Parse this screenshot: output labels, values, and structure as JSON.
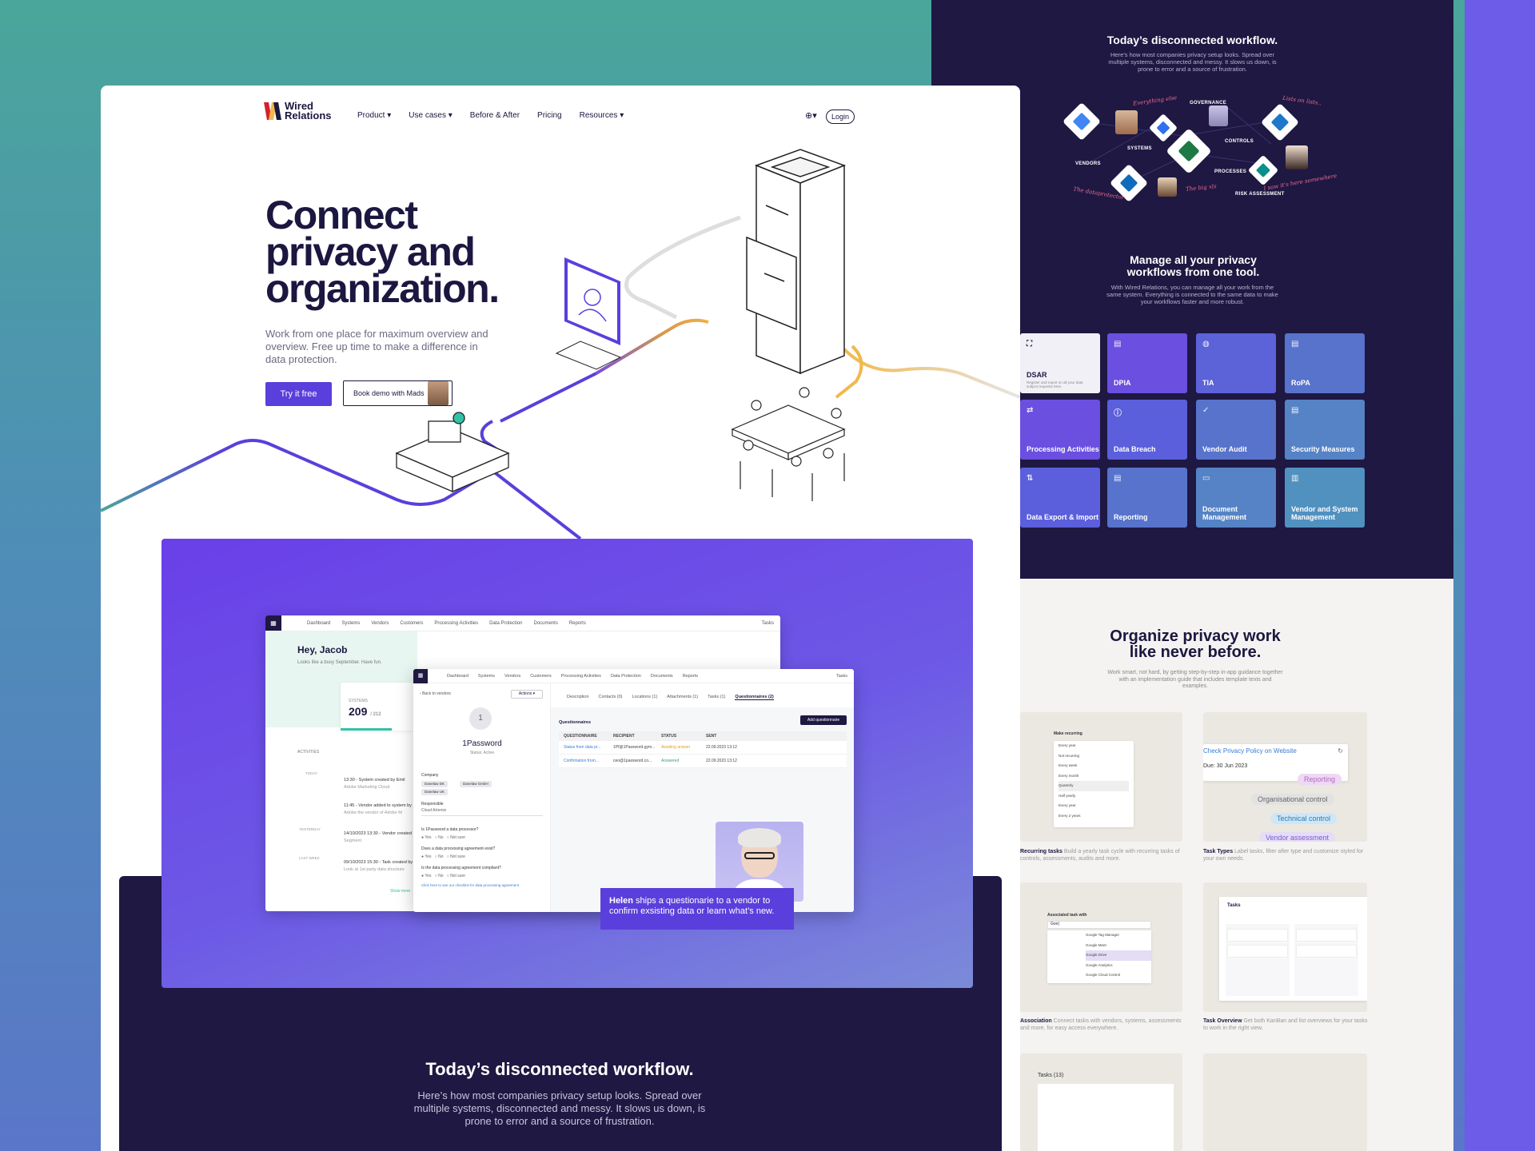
{
  "nav": {
    "logo_line1": "Wired",
    "logo_line2": "Relations",
    "items": [
      "Product",
      "Use cases",
      "Before & After",
      "Pricing",
      "Resources"
    ],
    "login": "Login"
  },
  "hero": {
    "title": "Connect privacy and organization.",
    "subtitle": "Work from one place for maximum overview and overview. Free up time to make a difference in data protection.",
    "cta_primary": "Try it free",
    "cta_secondary": "Book demo with Mads"
  },
  "app_back": {
    "tabs": [
      "Dashboard",
      "Systems",
      "Vendors",
      "Customers",
      "Processing Activities",
      "Data Protection",
      "Documents",
      "Reports"
    ],
    "tasks": "Tasks",
    "greeting": "Hey, Jacob",
    "greeting_sub": "Looks like a busy September. Have fun.",
    "stat_label": "SYSTEMS",
    "stat_value": "209",
    "stat_total": "/ 212",
    "activity_label": "ACTIVITIES",
    "timeline": [
      {
        "title": "13:30 - System created by Emil",
        "sub": "Adobe Marketing Cloud"
      },
      {
        "title": "11:45 - Vendor added to system by",
        "sub": "Adobe the vendor of Adobe M"
      },
      {
        "title": "14/10/2023 13:30 - Vendor created",
        "sub": "Segment"
      },
      {
        "title": "09/10/2023 15:30 - Task created by",
        "sub": "Look at 1st party data structure"
      }
    ],
    "side_labels": [
      "TODAY",
      "YESTERDAY",
      "LAST WEEK"
    ],
    "show_more": "Show more"
  },
  "app_front": {
    "tabs": [
      "Dashboard",
      "Systems",
      "Vendors",
      "Customers",
      "Processing Activities",
      "Data Protection",
      "Documents",
      "Reports"
    ],
    "tasks": "Tasks",
    "back": "Back to vendors",
    "actions": "Actions",
    "vendor_initial": "1",
    "vendor_name": "1Password",
    "vendor_status": "Status: Active",
    "company_label": "Company",
    "chips": [
      "Danelaw DK",
      "Danelaw GmbH",
      "Danelaw UK"
    ],
    "responsible_label": "Responsible",
    "responsible_value": "Cloud Artemis",
    "q1": "Is 1Password a data processor?",
    "q2": "Does a data processing agreement exist?",
    "q3": "Is the data processing agreement compliant?",
    "answers": [
      "Yes",
      "No",
      "Not sure"
    ],
    "q_link": "Click here to see our checklist for data processing agreement",
    "detail_tabs": [
      "Description",
      "Contacts (0)",
      "Locations (1)",
      "Attachments (1)",
      "Tasks (1)",
      "Questionnaires (2)"
    ],
    "q_section": "Questionnaires",
    "add_button": "Add questionnaire",
    "table_head": [
      "QUESTIONNAIRE",
      "RECIPIENT",
      "STATUS",
      "SENT"
    ],
    "rows": [
      [
        "Status from data pr...",
        "1Pf@1Password.gym...",
        "Awaiting answer",
        "22.09.2023 13:12"
      ],
      [
        "Confirmation from...",
        "ceo@1password.co...",
        "Answered",
        "22.09.2023 13:12"
      ]
    ]
  },
  "helen_caption": {
    "name": "Helen",
    "text": " ships a questionarie to a vendor to confirm exsisting data or learn what’s new."
  },
  "bottom": {
    "title": "Today’s disconnected workflow.",
    "subtitle": "Here’s how most companies privacy setup looks. Spread over multiple systems, disconnected and messy. It slows us down, is prone to error and a source of frustration."
  },
  "right_panel": {
    "title": "Today’s disconnected workflow.",
    "subtitle": "Here’s how most companies privacy setup looks. Spread over multiple systems, disconnected and messy. It slows us down, is prone to error and a source of frustration.",
    "flow_labels": [
      "GOVERNANCE",
      "SYSTEMS",
      "CONTROLS",
      "VENDORS",
      "PROCESSES",
      "RISK ASSESSMENT"
    ],
    "hand_notes": [
      "Everything else",
      "Lists on lists..",
      "The dataprotector",
      "The big xls",
      "I saw it's here somewhere"
    ],
    "title2": "Manage all your privacy workflows from one tool.",
    "subtitle2": "With Wired Relations, you can manage all your work from the same system. Everything is connected to the same data to make your workflows faster and more robust.",
    "dsar_desc": "Register and report on all your data subject requests here.",
    "tiles": [
      "DSAR",
      "DPIA",
      "TIA",
      "RoPA",
      "Processing Activities",
      "Data Breach",
      "Vendor Audit",
      "Security Measures",
      "Data Export & Import",
      "Reporting",
      "Document Management",
      "Vendor and System Management"
    ]
  },
  "light_panel": {
    "title": "Organize privacy work like never before.",
    "subtitle": "Work smart, not hard, by getting step-by-step in-app guidance together with an implementation guide that includes template texts and examples.",
    "recurring_header": "Make recurring",
    "recurring_options": [
      "Every year",
      "Not recurring",
      "Every week",
      "Every month",
      "Quarterly",
      "Half yearly",
      "Every year",
      "Every 2 years"
    ],
    "task_title": "Check Privacy Policy on Website",
    "task_due": "Due: 30 Jun 2023",
    "task_tags": [
      "Reporting",
      "Organisational control",
      "Technical control",
      "Vendor assessment"
    ],
    "caption1_b": "Recurring tasks",
    "caption1": " Build a yearly task cycle with recurring tasks of controls, assessments, audits and more.",
    "caption2_b": "Task Types",
    "caption2": " Label tasks, filter after type and customize styled for your own needs.",
    "assoc_header": "Associated task with",
    "assoc_options": [
      "Google Tag Manager",
      "Google Meet",
      "Google Drive",
      "Google Analytics",
      "Google Cloud Control"
    ],
    "caption3_b": "Association",
    "caption3": " Connect tasks with vendors, systems, assessments and more, for easy access everywhere.",
    "caption4_b": "Task Overview",
    "caption4": " Get both KanBan and list overviews for your tasks to work in the right view.",
    "tasks_label": "Tasks (13)",
    "tasks_board": "Tasks"
  }
}
